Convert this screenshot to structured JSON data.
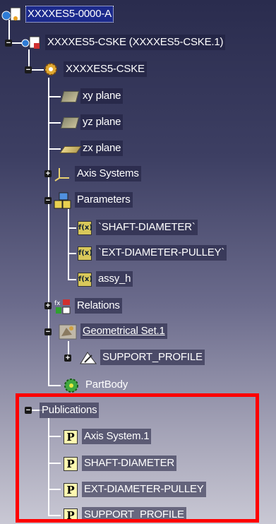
{
  "tree": {
    "root": "XXXXES5-0000-A",
    "product": "XXXXES5-CSKE (XXXXES5-CSKE.1)",
    "part": "XXXXES5-CSKE",
    "xy_plane": "xy plane",
    "yz_plane": "yz plane",
    "zx_plane": "zx plane",
    "axis_systems": "Axis Systems",
    "parameters": "Parameters",
    "param_shaft": "`SHAFT-DIAMETER`",
    "param_ext": "`EXT-DIAMETER-PULLEY`",
    "param_assy": "assy_h",
    "relations": "Relations",
    "geoset": "Geometrical Set.1",
    "support_profile": "SUPPORT_PROFILE",
    "partbody": "PartBody",
    "publications": "Publications",
    "pub_axis": "Axis System.1",
    "pub_shaft": "SHAFT-DIAMETER",
    "pub_ext": "EXT-DIAMETER-PULLEY",
    "pub_support": "SUPPORT_PROFILE"
  },
  "icons": {
    "param": "f(x)",
    "publication": "P"
  },
  "colors": {
    "highlight": "#ff0000",
    "selected": "#1c2a8c",
    "line": "#ffffff"
  }
}
